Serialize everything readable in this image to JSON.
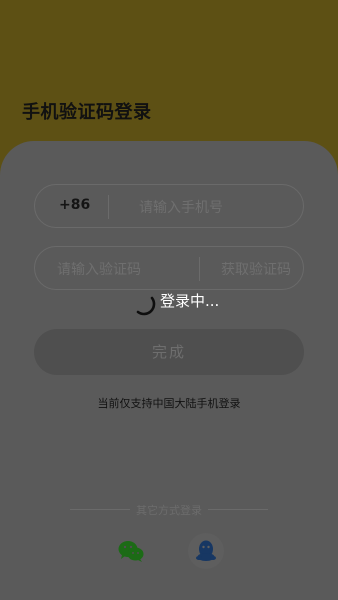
{
  "header": {
    "title": "手机验证码登录"
  },
  "form": {
    "country_code": "+86",
    "phone_placeholder": "请输入手机号",
    "code_placeholder": "请输入验证码",
    "get_code_label": "获取验证码",
    "submit_label": "完成",
    "notice": "当前仅支持中国大陆手机登录"
  },
  "other_login": {
    "label": "其它方式登录",
    "methods": [
      "wechat-icon",
      "qq-icon"
    ]
  },
  "overlay": {
    "loading_text": "登录中..."
  },
  "colors": {
    "brand_yellow": "#f7d13a",
    "wechat_green": "#1a7f12",
    "qq_blue": "#1a3f7a"
  }
}
